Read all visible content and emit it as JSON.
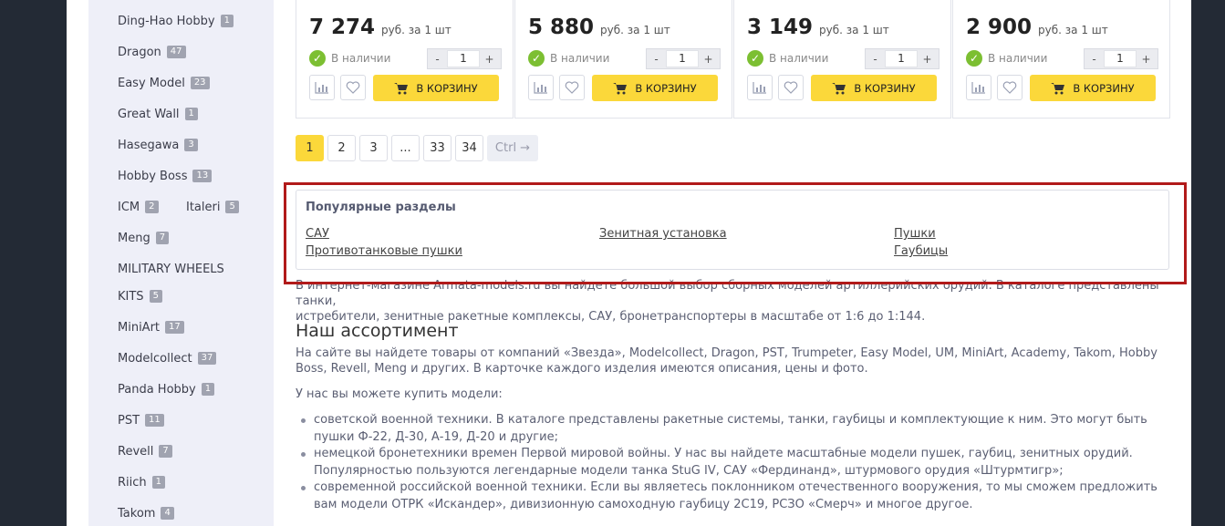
{
  "sidebar": {
    "brands": [
      {
        "name": "Ding-Hao Hobby",
        "count": "1"
      },
      {
        "name": "Dragon",
        "count": "47"
      },
      {
        "name": "Easy Model",
        "count": "23"
      },
      {
        "name": "Great Wall",
        "count": "1"
      },
      {
        "name": "Hasegawa",
        "count": "3"
      },
      {
        "name": "Hobby Boss",
        "count": "13"
      },
      {
        "name": "ICM",
        "count": "2"
      },
      {
        "name": "Italeri",
        "count": "5"
      },
      {
        "name": "Meng",
        "count": "7"
      },
      {
        "name": "MILITARY WHEELS",
        "count": ""
      },
      {
        "name": "KITS",
        "count": "5"
      },
      {
        "name": "MiniArt",
        "count": "17"
      },
      {
        "name": "Modelcollect",
        "count": "37"
      },
      {
        "name": "Panda Hobby",
        "count": "1"
      },
      {
        "name": "PST",
        "count": "11"
      },
      {
        "name": "Revell",
        "count": "7"
      },
      {
        "name": "Riich",
        "count": "1"
      },
      {
        "name": "Takom",
        "count": "4"
      }
    ]
  },
  "products": [
    {
      "price": "7 274",
      "unit": "руб. за 1 шт",
      "stock": "В наличии",
      "qty": "1",
      "cart": "В КОРЗИНУ"
    },
    {
      "price": "5 880",
      "unit": "руб. за 1 шт",
      "stock": "В наличии",
      "qty": "1",
      "cart": "В КОРЗИНУ"
    },
    {
      "price": "3 149",
      "unit": "руб. за 1 шт",
      "stock": "В наличии",
      "qty": "1",
      "cart": "В КОРЗИНУ"
    },
    {
      "price": "2 900",
      "unit": "руб. за 1 шт",
      "stock": "В наличии",
      "qty": "1",
      "cart": "В КОРЗИНУ"
    }
  ],
  "stepper": {
    "minus": "-",
    "plus": "+"
  },
  "pagination": {
    "pages": [
      "1",
      "2",
      "3",
      "...",
      "33",
      "34"
    ],
    "next": "Ctrl →",
    "active": "1"
  },
  "popular": {
    "title": "Популярные разделы",
    "links": [
      "САУ",
      "Зенитная установка",
      "Пушки",
      "Противотанковые пушки",
      "Гаубицы"
    ]
  },
  "content": {
    "intro_line1": "В интернет-магазине Armata-models.ru вы найдете большой выбор сборных моделей артиллерийских орудий. В каталоге представлены танки,",
    "intro_line2": "истребители, зенитные ракетные комплексы, САУ, бронетранспортеры в масштабе от 1:6 до 1:144.",
    "heading": "Наш ассортимент",
    "para1": "На сайте вы найдете товары от компаний «Звезда», Modelcollect, Dragon, PST, Trumpeter, Easy Model, UM, MiniArt, Academy, Takom, Hobby Boss, Revell, Meng и других. В карточке каждого изделия имеются описания, цены и фото.",
    "para2": "У нас вы можете купить модели:",
    "list": [
      "советской военной техники. В каталоге представлены ракетные системы, танки, гаубицы и комплектующие к ним. Это могут быть пушки Ф-22, Д-30, А-19, Д-20 и другие;",
      "немецкой бронетехники времен Первой мировой войны. У нас вы найдете масштабные модели пушек, гаубиц, зенитных орудий. Популярностью пользуются легендарные модели танка StuG IV, САУ «Фердинанд», штурмового орудия «Штурмтигр»;",
      "современной российской военной техники. Если вы являетесь поклонником отечественного вооружения, то мы сможем предложить вам модели ОТРК «Искандер», дивизионную самоходную гаубицу 2С19, РСЗО «Смерч» и многое другое."
    ]
  },
  "colors": {
    "accent": "#fbd83a",
    "stock": "#7cbf32",
    "highlight": "#b11a1a",
    "sidebar": "#eeeff8"
  }
}
